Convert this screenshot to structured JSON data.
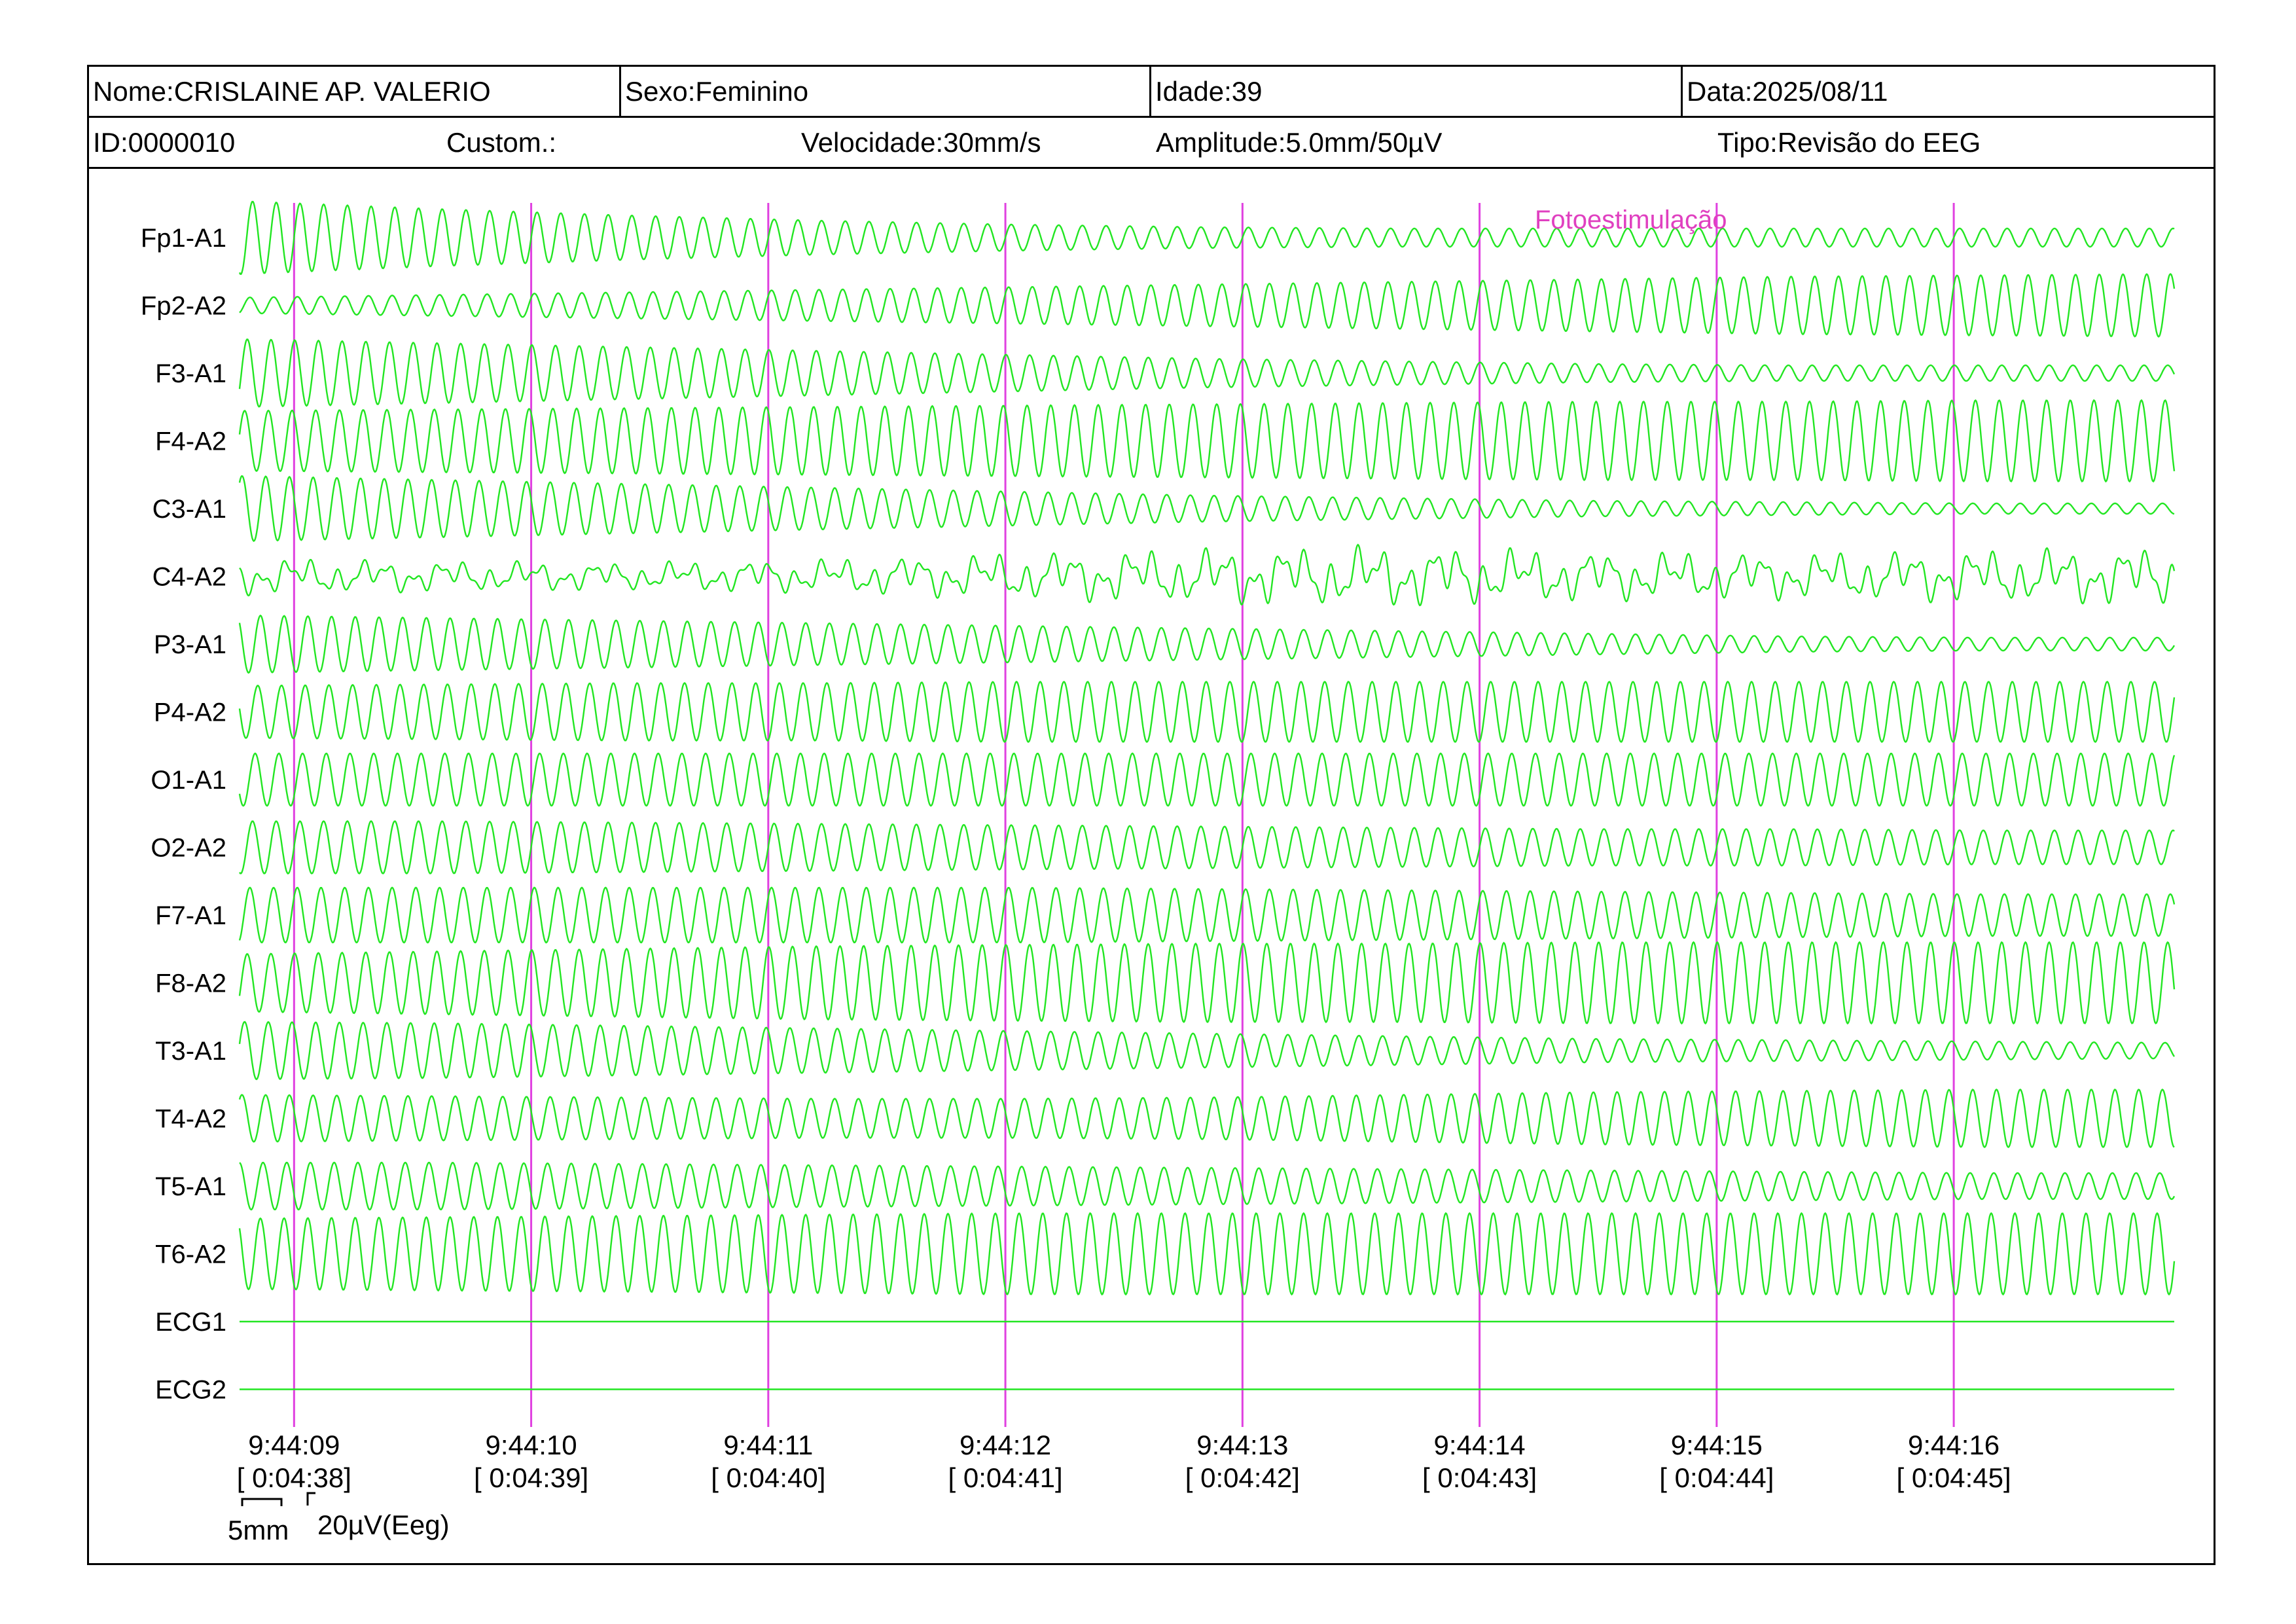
{
  "header": {
    "nome": "Nome:CRISLAINE AP. VALERIO",
    "sexo": "Sexo:Feminino",
    "idade": "Idade:39",
    "data": "Data:2025/08/11",
    "id": "ID:0000010",
    "custom": "Custom.:",
    "velocidade": "Velocidade:30mm/s",
    "amplitude": "Amplitude:5.0mm/50µV",
    "tipo": "Tipo:Revisão do EEG"
  },
  "chart_data": {
    "type": "line",
    "channels": [
      "Fp1-A1",
      "Fp2-A2",
      "F3-A1",
      "F4-A2",
      "C3-A1",
      "C4-A2",
      "P3-A1",
      "P4-A2",
      "O1-A1",
      "O2-A2",
      "F7-A1",
      "F8-A2",
      "T3-A1",
      "T4-A2",
      "T5-A1",
      "T6-A2",
      "ECG1",
      "ECG2"
    ],
    "time_marks": [
      {
        "clock": "9:44:09",
        "elapsed": "[ 0:04:38]"
      },
      {
        "clock": "9:44:10",
        "elapsed": "[ 0:04:39]"
      },
      {
        "clock": "9:44:11",
        "elapsed": "[ 0:04:40]"
      },
      {
        "clock": "9:44:12",
        "elapsed": "[ 0:04:41]"
      },
      {
        "clock": "9:44:13",
        "elapsed": "[ 0:04:42]"
      },
      {
        "clock": "9:44:14",
        "elapsed": "[ 0:04:43]"
      },
      {
        "clock": "9:44:15",
        "elapsed": "[ 0:04:44]"
      },
      {
        "clock": "9:44:16",
        "elapsed": "[ 0:04:45]"
      }
    ],
    "event_label": "Fotoestimulação",
    "scale_time": "5mm",
    "scale_amp": "20µV(Eeg)",
    "trace_color": "#22e622",
    "marker_color": "#e040e0",
    "event_color": "#e040c0",
    "x_range_seconds": [
      -0.23,
      7.93
    ],
    "traces": [
      {
        "shape": "osc",
        "amp": [
          56,
          44,
          34,
          26,
          20,
          16,
          14,
          14,
          14,
          14,
          14
        ]
      },
      {
        "shape": "osc",
        "amp": [
          12,
          16,
          20,
          24,
          28,
          32,
          36,
          40,
          44,
          46,
          48
        ]
      },
      {
        "shape": "osc",
        "amp": [
          52,
          46,
          40,
          34,
          28,
          22,
          18,
          14,
          12,
          12,
          12
        ]
      },
      {
        "shape": "osc",
        "amp": [
          46,
          48,
          50,
          52,
          54,
          56,
          58,
          60,
          60,
          62,
          62
        ]
      },
      {
        "shape": "osc",
        "amp": [
          50,
          44,
          38,
          32,
          26,
          20,
          16,
          12,
          10,
          8,
          8
        ]
      },
      {
        "shape": "irr",
        "amp": [
          24,
          20,
          18,
          22,
          30,
          36,
          40,
          32,
          30,
          34,
          38
        ]
      },
      {
        "shape": "osc",
        "amp": [
          44,
          40,
          36,
          32,
          28,
          24,
          20,
          16,
          12,
          10,
          10
        ]
      },
      {
        "shape": "osc",
        "amp": [
          40,
          42,
          44,
          44,
          46,
          46,
          46,
          46,
          46,
          46,
          46
        ]
      },
      {
        "shape": "osc",
        "amp": [
          40,
          40,
          40,
          40,
          40,
          40,
          40,
          40,
          40,
          40,
          40
        ]
      },
      {
        "shape": "osc",
        "amp": [
          40,
          40,
          38,
          36,
          34,
          32,
          30,
          28,
          28,
          26,
          26
        ]
      },
      {
        "shape": "osc",
        "amp": [
          42,
          42,
          42,
          42,
          42,
          40,
          38,
          36,
          34,
          32,
          32
        ]
      },
      {
        "shape": "osc",
        "amp": [
          44,
          48,
          52,
          56,
          58,
          60,
          60,
          62,
          62,
          62,
          62
        ]
      },
      {
        "shape": "osc",
        "amp": [
          44,
          42,
          38,
          34,
          30,
          26,
          22,
          18,
          16,
          14,
          12
        ]
      },
      {
        "shape": "osc",
        "amp": [
          36,
          34,
          32,
          30,
          30,
          32,
          36,
          40,
          42,
          44,
          44
        ]
      },
      {
        "shape": "osc",
        "amp": [
          36,
          36,
          34,
          32,
          30,
          28,
          26,
          24,
          22,
          20,
          20
        ]
      },
      {
        "shape": "osc",
        "amp": [
          54,
          56,
          58,
          60,
          62,
          62,
          62,
          62,
          62,
          62,
          62
        ]
      },
      {
        "shape": "flat",
        "amp": [
          0
        ]
      },
      {
        "shape": "flat",
        "amp": [
          0
        ]
      }
    ]
  }
}
